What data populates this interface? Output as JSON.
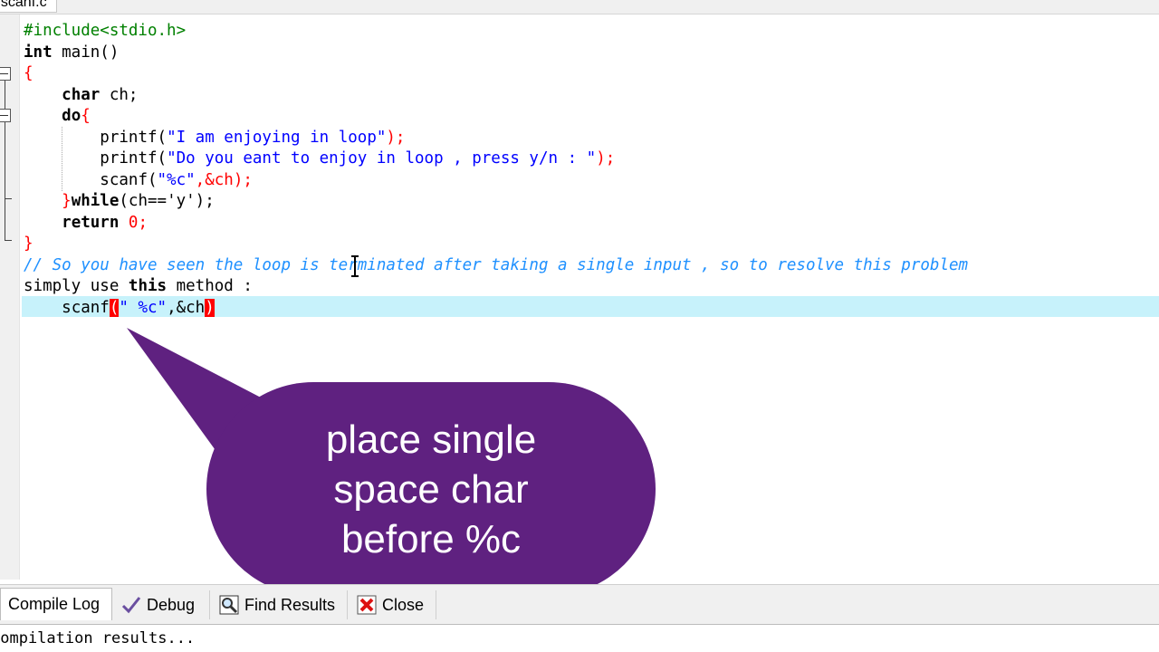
{
  "editor": {
    "file_tab": "nscanf.c",
    "lines": {
      "l1_pre": "#include<stdio.h>",
      "l2_kw": "int",
      "l2_rest": " main()",
      "l3_brace": "{",
      "l4_kw": "char",
      "l4_rest": " ch;",
      "l5_kw": "do",
      "l5_brace": "{",
      "l6_fn": "printf(",
      "l6_str": "\"I am enjoying in loop\"",
      "l6_end": ");",
      "l7_fn": "printf(",
      "l7_str": "\"Do you eant to enjoy in loop , press y/n : \"",
      "l7_end": ");",
      "l8_fn": "scanf(",
      "l8_str": "\"%c\"",
      "l8_rest": ",&ch);",
      "l9_brace": "}",
      "l9_kw": "while",
      "l9_rest": "(ch=='y');",
      "l10_kw": "return",
      "l10_num": "0",
      "l10_end": ";",
      "l11_brace": "}",
      "l12_comment": "// So you have seen the loop is terminated after taking a single input , so to resolve this problem",
      "l13_a": "simply use ",
      "l13_kw": "this",
      "l13_b": " method :",
      "l14_fn": "scanf",
      "l14_open": "(",
      "l14_str": "\" %c\"",
      "l14_rest": ",&ch",
      "l14_close": ")"
    }
  },
  "callout": {
    "line1": "place single",
    "line2": "space char",
    "line3": "before %c",
    "color": "#5f2180"
  },
  "bottom_tabs": {
    "compile_log": "Compile Log",
    "debug": "Debug",
    "find_results": "Find Results",
    "close": "Close"
  },
  "output": {
    "text": "Compilation results..."
  }
}
